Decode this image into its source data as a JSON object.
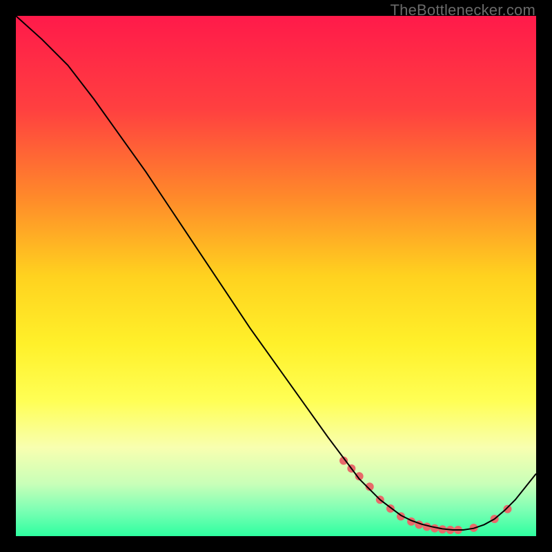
{
  "watermark": "TheBottlenecker.com",
  "chart_data": {
    "type": "line",
    "title": "",
    "xlabel": "",
    "ylabel": "",
    "xlim": [
      0,
      100
    ],
    "ylim": [
      0,
      100
    ],
    "grid": false,
    "background": {
      "type": "vertical-gradient",
      "stops": [
        {
          "pos": 0.0,
          "color": "#ff1a4a"
        },
        {
          "pos": 0.18,
          "color": "#ff4040"
        },
        {
          "pos": 0.35,
          "color": "#ff8a2a"
        },
        {
          "pos": 0.5,
          "color": "#ffd21f"
        },
        {
          "pos": 0.63,
          "color": "#fff02a"
        },
        {
          "pos": 0.74,
          "color": "#ffff55"
        },
        {
          "pos": 0.83,
          "color": "#f8ffb0"
        },
        {
          "pos": 0.9,
          "color": "#c8ffb8"
        },
        {
          "pos": 0.95,
          "color": "#7dffb4"
        },
        {
          "pos": 1.0,
          "color": "#2effa0"
        }
      ]
    },
    "series": [
      {
        "name": "bottleneck-curve",
        "color": "#000000",
        "x": [
          0,
          5,
          10,
          15,
          20,
          25,
          30,
          35,
          40,
          45,
          50,
          55,
          60,
          63,
          66,
          70,
          72,
          74,
          76,
          78,
          80,
          82,
          84,
          86,
          88,
          90,
          92,
          94,
          96,
          98,
          100
        ],
        "y": [
          100,
          95.5,
          90.5,
          84,
          77,
          70,
          62.5,
          55,
          47.5,
          40,
          33,
          26,
          19,
          15,
          11,
          7,
          5.5,
          4,
          3,
          2.3,
          1.8,
          1.4,
          1.2,
          1.2,
          1.5,
          2.2,
          3.3,
          5,
          7,
          9.5,
          12
        ]
      }
    ],
    "markers": {
      "name": "highlight-points",
      "color": "#e86a6a",
      "x": [
        63,
        64.5,
        66,
        68,
        70,
        72,
        74,
        76,
        77.5,
        79,
        80.5,
        82,
        83.5,
        85,
        88,
        92,
        94.5
      ],
      "y": [
        14.5,
        13,
        11.5,
        9.5,
        7,
        5.3,
        3.8,
        2.8,
        2.2,
        1.8,
        1.5,
        1.3,
        1.2,
        1.2,
        1.6,
        3.3,
        5.2
      ]
    }
  }
}
